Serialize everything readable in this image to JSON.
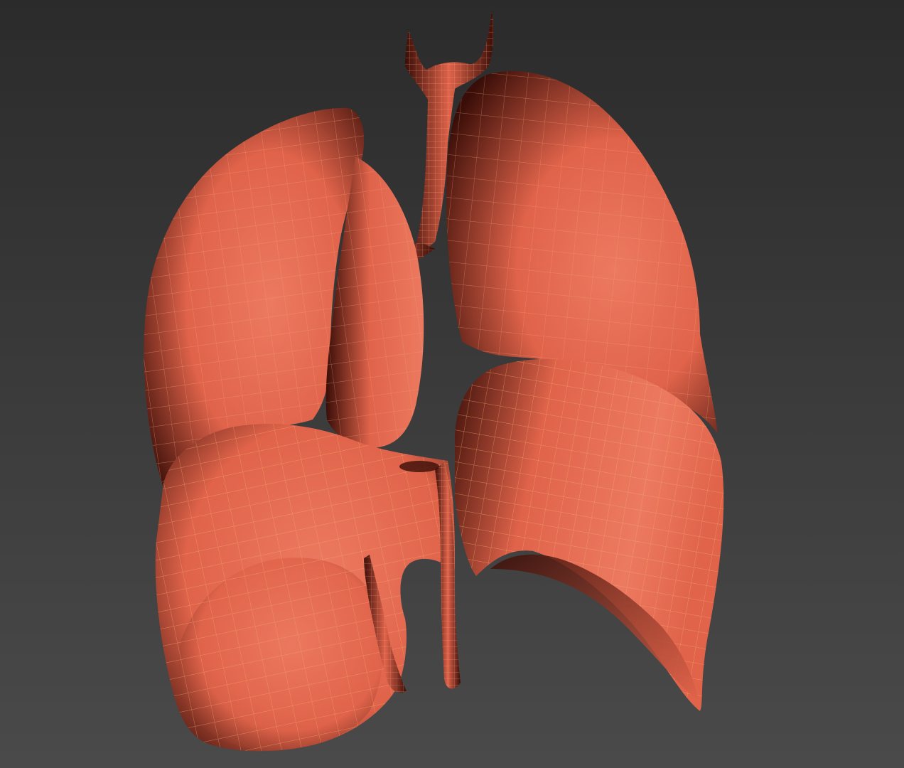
{
  "viewport": {
    "background_top": "#2b2b2b",
    "background_bottom": "#4a4a4a",
    "mesh_fill": "#e0634a",
    "mesh_highlight": "#ec7a60",
    "mesh_shadow": "#3a0e08",
    "wire_color": "#f3a27a",
    "liver_wire_color": "#f4b070"
  }
}
